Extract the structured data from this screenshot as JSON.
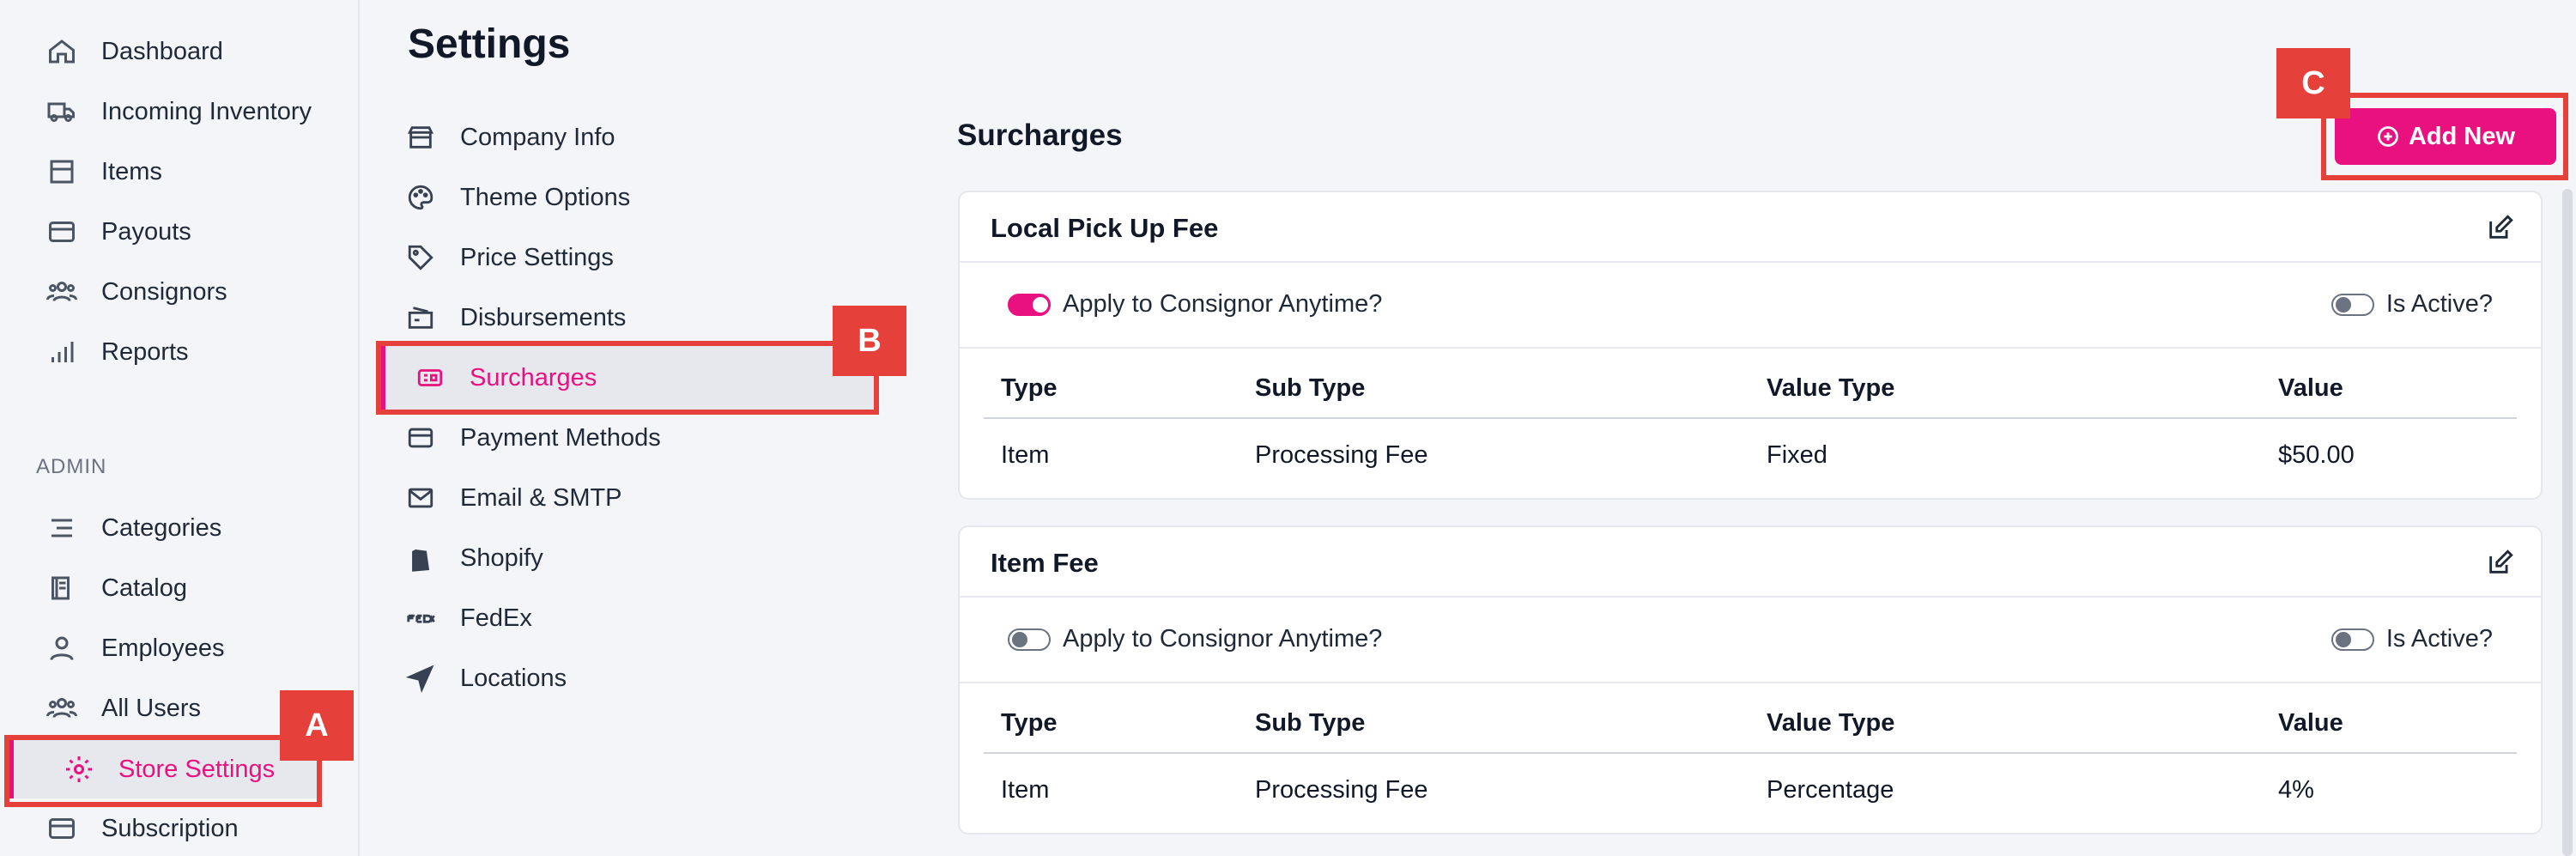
{
  "sidebar": {
    "items": [
      {
        "label": "Dashboard",
        "icon": "home-icon"
      },
      {
        "label": "Incoming Inventory",
        "icon": "truck-icon"
      },
      {
        "label": "Items",
        "icon": "box-icon"
      },
      {
        "label": "Payouts",
        "icon": "credit-card-icon"
      },
      {
        "label": "Consignors",
        "icon": "users-icon"
      },
      {
        "label": "Reports",
        "icon": "bar-chart-icon"
      }
    ],
    "admin_label": "ADMIN",
    "admin_items": [
      {
        "label": "Categories",
        "icon": "list-icon"
      },
      {
        "label": "Catalog",
        "icon": "book-icon"
      },
      {
        "label": "Employees",
        "icon": "user-icon"
      },
      {
        "label": "All Users",
        "icon": "users-icon"
      },
      {
        "label": "Store Settings",
        "icon": "gear-icon",
        "active": true
      },
      {
        "label": "Subscription",
        "icon": "credit-card-icon"
      }
    ]
  },
  "settings": {
    "title": "Settings",
    "items": [
      {
        "label": "Company Info",
        "icon": "store-icon"
      },
      {
        "label": "Theme Options",
        "icon": "palette-icon"
      },
      {
        "label": "Price Settings",
        "icon": "tag-icon"
      },
      {
        "label": "Disbursements",
        "icon": "money-check-icon"
      },
      {
        "label": "Surcharges",
        "icon": "ticket-icon",
        "active": true
      },
      {
        "label": "Payment Methods",
        "icon": "credit-card-icon"
      },
      {
        "label": "Email & SMTP",
        "icon": "envelope-icon"
      },
      {
        "label": "Shopify",
        "icon": "shopify-icon"
      },
      {
        "label": "FedEx",
        "icon": "fedex-icon"
      },
      {
        "label": "Locations",
        "icon": "location-arrow-icon"
      }
    ]
  },
  "content": {
    "section_title": "Surcharges",
    "add_button_label": "Add New",
    "cards": [
      {
        "title": "Local Pick Up Fee",
        "apply_label": "Apply to Consignor Anytime?",
        "apply_on": true,
        "active_label": "Is Active?",
        "active_on": false,
        "columns": [
          "Type",
          "Sub Type",
          "Value Type",
          "Value"
        ],
        "rows": [
          [
            "Item",
            "Processing Fee",
            "Fixed",
            "$50.00"
          ]
        ]
      },
      {
        "title": "Item Fee",
        "apply_label": "Apply to Consignor Anytime?",
        "apply_on": false,
        "active_label": "Is Active?",
        "active_on": false,
        "columns": [
          "Type",
          "Sub Type",
          "Value Type",
          "Value"
        ],
        "rows": [
          [
            "Item",
            "Processing Fee",
            "Percentage",
            "4%"
          ]
        ]
      }
    ]
  },
  "annotations": {
    "a": "A",
    "b": "B",
    "c": "C"
  },
  "colors": {
    "accent": "#e8117f",
    "callout": "#e5403a"
  }
}
